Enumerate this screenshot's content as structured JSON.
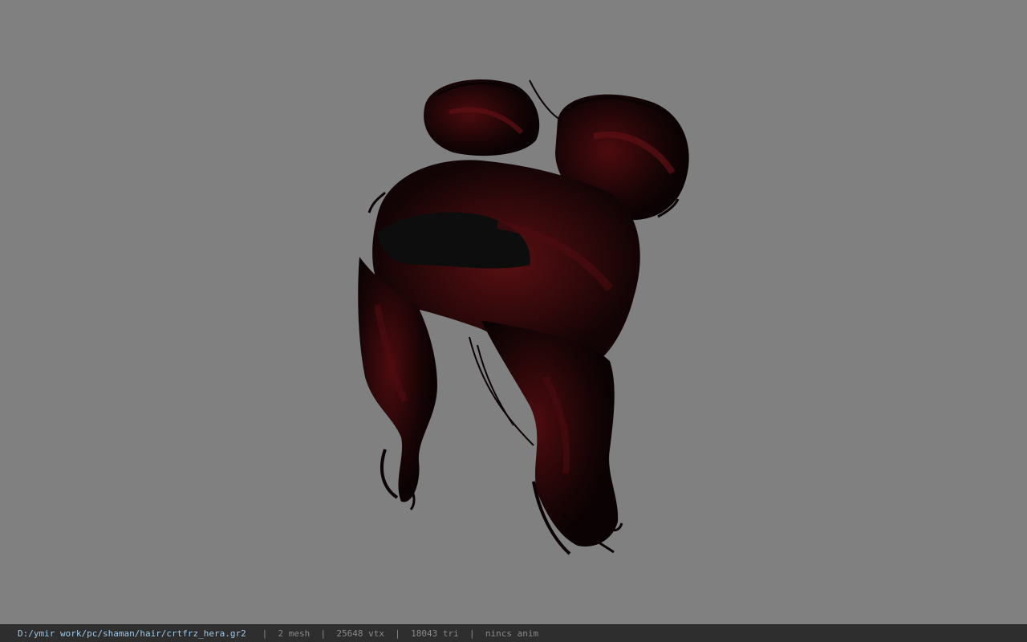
{
  "viewport": {
    "background_color": "#808080",
    "model_description_icon": "hair-model-icon"
  },
  "statusbar": {
    "file_path": "D:/ymir work/pc/shaman/hair/crtfrz_hera.gr2",
    "separator": "|",
    "mesh_count": "2 mesh",
    "vertex_count": "25648 vtx",
    "triangle_count": "18043 tri",
    "anim_status": "nincs anim",
    "path_color": "#9ec9e8",
    "text_color": "#8a8a8a"
  }
}
